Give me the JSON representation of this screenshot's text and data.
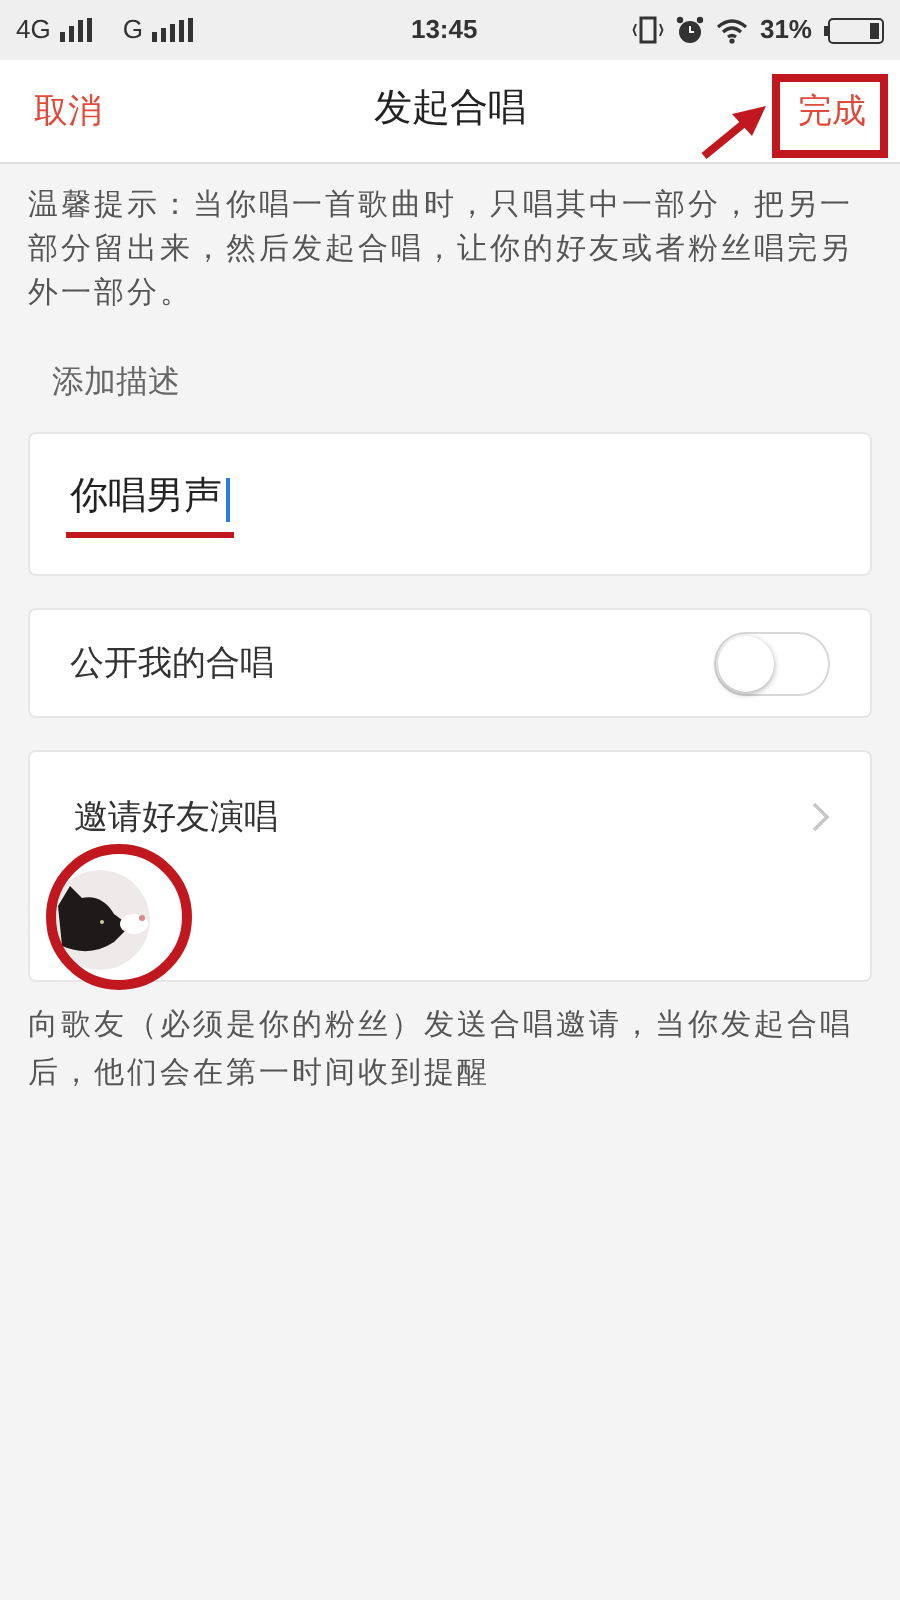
{
  "status_bar": {
    "network_1": "4G",
    "network_2": "G",
    "time": "13:45",
    "battery": "31%"
  },
  "nav": {
    "cancel": "取消",
    "title": "发起合唱",
    "done": "完成"
  },
  "hint": "温馨提示：当你唱一首歌曲时，只唱其中一部分，把另一部分留出来，然后发起合唱，让你的好友或者粉丝唱完另外一部分。",
  "description_label": "添加描述",
  "description": {
    "value": "你唱男声"
  },
  "public_toggle": {
    "label": "公开我的合唱",
    "on": false
  },
  "invite": {
    "label": "邀请好友演唱"
  },
  "invite_note": "向歌友（必须是你的粉丝）发送合唱邀请，当你发起合唱后，他们会在第一时间收到提醒"
}
